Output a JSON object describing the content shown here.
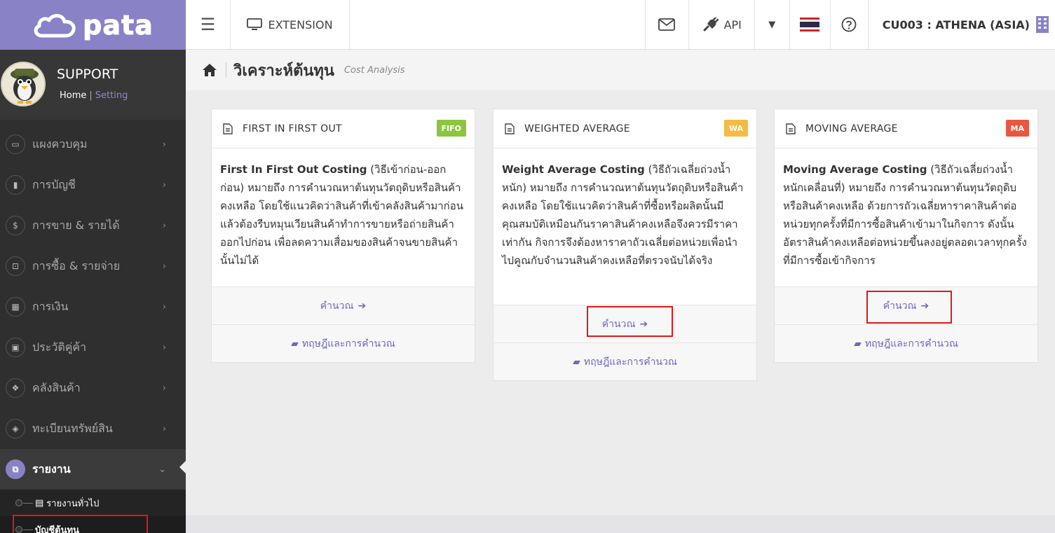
{
  "brand": {
    "name": "pata"
  },
  "profile": {
    "name": "SUPPORT",
    "home_link": "Home",
    "separator": "|",
    "setting_link": "Setting"
  },
  "sidebar": {
    "items": [
      {
        "label": "แผงควบคุม",
        "icon": "monitor-icon"
      },
      {
        "label": "การบัญชี",
        "icon": "book-icon"
      },
      {
        "label": "การขาย & รายได้",
        "icon": "dollar-icon"
      },
      {
        "label": "การซื้อ & รายจ่าย",
        "icon": "cart-icon"
      },
      {
        "label": "การเงิน",
        "icon": "calendar-icon"
      },
      {
        "label": "ประวัติคู่ค้า",
        "icon": "contact-icon"
      },
      {
        "label": "คลังสินค้า",
        "icon": "boxes-icon"
      },
      {
        "label": "ทะเบียนทรัพย์สิน",
        "icon": "asset-icon"
      },
      {
        "label": "รายงาน",
        "icon": "report-icon",
        "active": true
      }
    ],
    "subitems": [
      {
        "label": "รายงานทั่วไป"
      },
      {
        "label": "บัญชีต้นทุน"
      }
    ]
  },
  "topbar": {
    "extension_label": "EXTENSION",
    "api_label": "API",
    "company_label": "CU003 : ATHENA (ASIA)"
  },
  "breadcrumb": {
    "title_th": "วิเคราะห์ต้นทุน",
    "title_en": "Cost Analysis"
  },
  "cards": [
    {
      "title": "FIRST IN FIRST OUT",
      "badge": "FIFO",
      "badge_color": "#8cc63f",
      "lead": "First In First Out Costing",
      "body": " (วิธีเข้าก่อน-ออกก่อน) หมายถึง การคำนวณหาต้นทุนวัตถุดิบหรือสินค้าคงเหลือ โดยใช้แนวคิดว่าสินค้าที่เข้าคลังสินค้ามาก่อนแล้วต้องรีบหมุนเวียนสินค้าทำการขายหรือถ่ายสินค้าออกไปก่อน เพื่อลดความเสื่อมของสินค้าจนขายสินค้านั้นไม่ได้",
      "calc_label": "คำนวณ",
      "theory_label": "ทฤษฎีและการคำนวณ"
    },
    {
      "title": "WEIGHTED AVERAGE",
      "badge": "WA",
      "badge_color": "#f6bb42",
      "lead": "Weight Average Costing",
      "body": " (วิธีถัวเฉลี่ยถ่วงน้ำหนัก) หมายถึง การคำนวณหาต้นทุนวัตถุดิบหรือสินค้าคงเหลือ โดยใช้แนวคิดว่าสินค้าที่ซื้อหรือผลิตนั้นมีคุณสมบัติเหมือนกันราคาสินค้าคงเหลือจึงควรมีราคาเท่ากัน กิจการจึงต้องหาราคาถัวเฉลี่ยต่อหน่วยเพื่อนำไปคูณกับจำนวนสินค้าคงเหลือที่ตรวจนับได้จริง",
      "calc_label": "คำนวณ",
      "theory_label": "ทฤษฎีและการคำนวณ"
    },
    {
      "title": "MOVING AVERAGE",
      "badge": "MA",
      "badge_color": "#e9573f",
      "lead": "Moving Average Costing",
      "body": " (วิธีถัวเฉลี่ยถ่วงน้ำหนักเคลื่อนที่) หมายถึง การคำนวณหาต้นทุนวัตถุดิบหรือสินค้าคงเหลือ ด้วยการถัวเฉลี่ยหาราคาสินค้าต่อหน่วยทุกครั้งที่มีการซื้อสินค้าเข้ามาในกิจการ ดังนั้นอัตราสินค้าคงเหลือต่อหน่วยขึ้นลงอยู่ตลอดเวลาทุกครั้งที่มีการซื้อเข้ากิจการ",
      "calc_label": "คำนวณ",
      "theory_label": "ทฤษฎีและการคำนวณ"
    }
  ]
}
